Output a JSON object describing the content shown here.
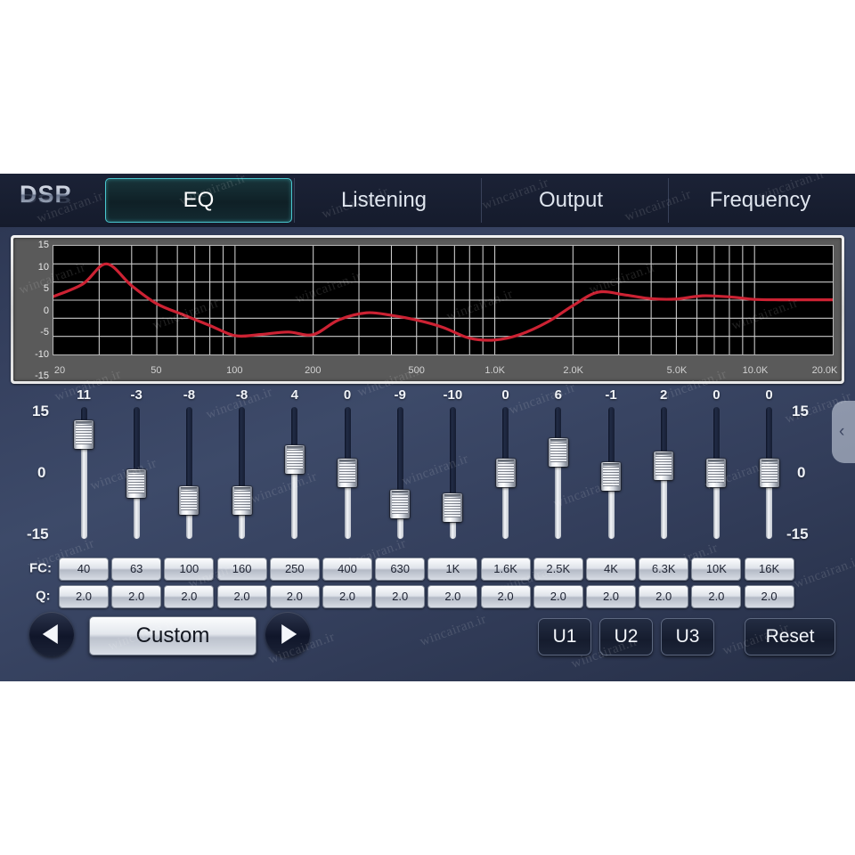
{
  "app": {
    "logo": "DSP",
    "accent": "#49c7cf",
    "curve_color": "#cc2233",
    "background": "#35405e"
  },
  "header": {
    "tabs": [
      {
        "label": "EQ",
        "active": true
      },
      {
        "label": "Listening",
        "active": false
      },
      {
        "label": "Output",
        "active": false
      },
      {
        "label": "Frequency",
        "active": false
      }
    ]
  },
  "graph": {
    "y_ticks": [
      "15",
      "10",
      "5",
      "0",
      "-5",
      "-10",
      "-15"
    ],
    "x_ticks": [
      "20",
      "50",
      "100",
      "200",
      "500",
      "1.0K",
      "2.0K",
      "5.0K",
      "10.0K",
      "20.0K"
    ]
  },
  "chart_data": {
    "type": "line",
    "title": "",
    "xlabel": "",
    "ylabel": "",
    "xlim": [
      20,
      20000
    ],
    "ylim": [
      -15,
      15
    ],
    "xscale": "log",
    "grid": true,
    "legend": "none",
    "series": [
      {
        "name": "EQ response",
        "color": "#cc2233",
        "x": [
          20,
          26,
          32,
          40,
          50,
          63,
          80,
          100,
          125,
          160,
          200,
          250,
          320,
          400,
          500,
          630,
          800,
          1000,
          1250,
          1600,
          2000,
          2500,
          3200,
          4000,
          5000,
          6300,
          8000,
          10000,
          12500,
          16000,
          20000
        ],
        "y": [
          1,
          4.5,
          10,
          4,
          -1,
          -4,
          -7,
          -9.8,
          -9.5,
          -8.8,
          -9.5,
          -5.5,
          -3.5,
          -4.2,
          -5.5,
          -7.5,
          -10.5,
          -11,
          -9.5,
          -6,
          -1.5,
          2.2,
          1.4,
          0.4,
          0.3,
          1.2,
          0.9,
          0.2,
          0.1,
          0.1,
          0.1
        ]
      }
    ]
  },
  "equalizer": {
    "scale_labels": [
      "15",
      "0",
      "-15"
    ],
    "fc_row_label": "FC:",
    "q_row_label": "Q:",
    "bands": [
      {
        "gain": "11",
        "fc": "40",
        "q": "2.0"
      },
      {
        "gain": "-3",
        "fc": "63",
        "q": "2.0"
      },
      {
        "gain": "-8",
        "fc": "100",
        "q": "2.0"
      },
      {
        "gain": "-8",
        "fc": "160",
        "q": "2.0"
      },
      {
        "gain": "4",
        "fc": "250",
        "q": "2.0"
      },
      {
        "gain": "0",
        "fc": "400",
        "q": "2.0"
      },
      {
        "gain": "-9",
        "fc": "630",
        "q": "2.0"
      },
      {
        "gain": "-10",
        "fc": "1K",
        "q": "2.0"
      },
      {
        "gain": "0",
        "fc": "1.6K",
        "q": "2.0"
      },
      {
        "gain": "6",
        "fc": "2.5K",
        "q": "2.0"
      },
      {
        "gain": "-1",
        "fc": "4K",
        "q": "2.0"
      },
      {
        "gain": "2",
        "fc": "6.3K",
        "q": "2.0"
      },
      {
        "gain": "0",
        "fc": "10K",
        "q": "2.0"
      },
      {
        "gain": "0",
        "fc": "16K",
        "q": "2.0"
      }
    ]
  },
  "controls": {
    "prev_icon": "triangle-left-icon",
    "next_icon": "triangle-right-icon",
    "preset": "Custom",
    "user_buttons": [
      "U1",
      "U2",
      "U3"
    ],
    "reset": "Reset",
    "side_handle_icon": "chevron-left-icon",
    "side_handle_glyph": "‹"
  },
  "watermark": {
    "text": "wincairan.ir"
  }
}
